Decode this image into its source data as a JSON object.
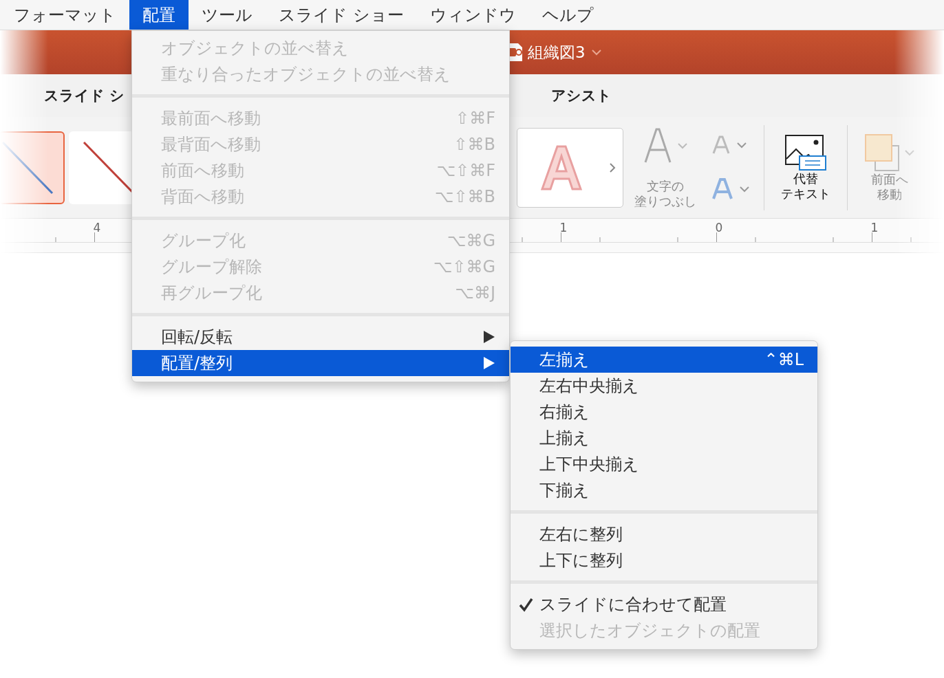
{
  "menu_bar": {
    "items": [
      {
        "label": "フォーマット",
        "selected": false
      },
      {
        "label": "配置",
        "selected": true
      },
      {
        "label": "ツール",
        "selected": false
      },
      {
        "label": "スライド ショー",
        "selected": false
      },
      {
        "label": "ウィンドウ",
        "selected": false
      },
      {
        "label": "ヘルプ",
        "selected": false
      }
    ]
  },
  "app_window": {
    "title": "組織図3",
    "ribbon_tabs": [
      {
        "label": "スライド シ"
      },
      {
        "label": "アシスト"
      }
    ],
    "shape_styles": [
      {
        "selected": true
      },
      {
        "selected": false
      }
    ],
    "ribbon_buttons": [
      {
        "kind": "fill",
        "label_lines": [
          "文字の",
          "塗りつぶし"
        ],
        "disabled": true
      },
      {
        "kind": "alt_text",
        "label_lines": [
          "代替",
          "テキスト"
        ],
        "disabled": false
      },
      {
        "kind": "bring_forward",
        "label_lines": [
          "前面へ",
          "移動"
        ],
        "disabled": true
      }
    ],
    "ruler": {
      "labels": [
        "4",
        "1",
        "0",
        "1"
      ]
    }
  },
  "menu": {
    "sections": [
      {
        "items": [
          {
            "label": "オブジェクトの並べ替え",
            "disabled": true,
            "selected": false,
            "has_submenu": false
          },
          {
            "label": "重なり合ったオブジェクトの並べ替え",
            "disabled": true,
            "selected": false,
            "has_submenu": false
          }
        ]
      },
      {
        "items": [
          {
            "label": "最前面へ移動",
            "shortcut": "⇧⌘F",
            "disabled": true,
            "selected": false,
            "has_submenu": false
          },
          {
            "label": "最背面へ移動",
            "shortcut": "⇧⌘B",
            "disabled": true,
            "selected": false,
            "has_submenu": false
          },
          {
            "label": "前面へ移動",
            "shortcut": "⌥⇧⌘F",
            "disabled": true,
            "selected": false,
            "has_submenu": false
          },
          {
            "label": "背面へ移動",
            "shortcut": "⌥⇧⌘B",
            "disabled": true,
            "selected": false,
            "has_submenu": false
          }
        ]
      },
      {
        "items": [
          {
            "label": "グループ化",
            "shortcut": "⌥⌘G",
            "disabled": true,
            "selected": false,
            "has_submenu": false
          },
          {
            "label": "グループ解除",
            "shortcut": "⌥⇧⌘G",
            "disabled": true,
            "selected": false,
            "has_submenu": false
          },
          {
            "label": "再グループ化",
            "shortcut": "⌥⌘J",
            "disabled": true,
            "selected": false,
            "has_submenu": false
          }
        ]
      },
      {
        "items": [
          {
            "label": "回転/反転",
            "disabled": false,
            "selected": false,
            "has_submenu": true
          },
          {
            "label": "配置/整列",
            "disabled": false,
            "selected": true,
            "has_submenu": true
          }
        ]
      }
    ]
  },
  "submenu": {
    "sections": [
      {
        "items": [
          {
            "label": "左揃え",
            "shortcut": "⌃⌘L",
            "disabled": false,
            "selected": true,
            "checked": false
          },
          {
            "label": "左右中央揃え",
            "disabled": false,
            "selected": false,
            "checked": false
          },
          {
            "label": "右揃え",
            "disabled": false,
            "selected": false,
            "checked": false
          },
          {
            "label": "上揃え",
            "disabled": false,
            "selected": false,
            "checked": false
          },
          {
            "label": "上下中央揃え",
            "disabled": false,
            "selected": false,
            "checked": false
          },
          {
            "label": "下揃え",
            "disabled": false,
            "selected": false,
            "checked": false
          }
        ]
      },
      {
        "items": [
          {
            "label": "左右に整列",
            "disabled": false,
            "selected": false,
            "checked": false
          },
          {
            "label": "上下に整列",
            "disabled": false,
            "selected": false,
            "checked": false
          }
        ]
      },
      {
        "items": [
          {
            "label": "スライドに合わせて配置",
            "disabled": false,
            "selected": false,
            "checked": true
          },
          {
            "label": "選択したオブジェクトの配置",
            "disabled": true,
            "selected": false,
            "checked": false
          }
        ]
      }
    ]
  }
}
